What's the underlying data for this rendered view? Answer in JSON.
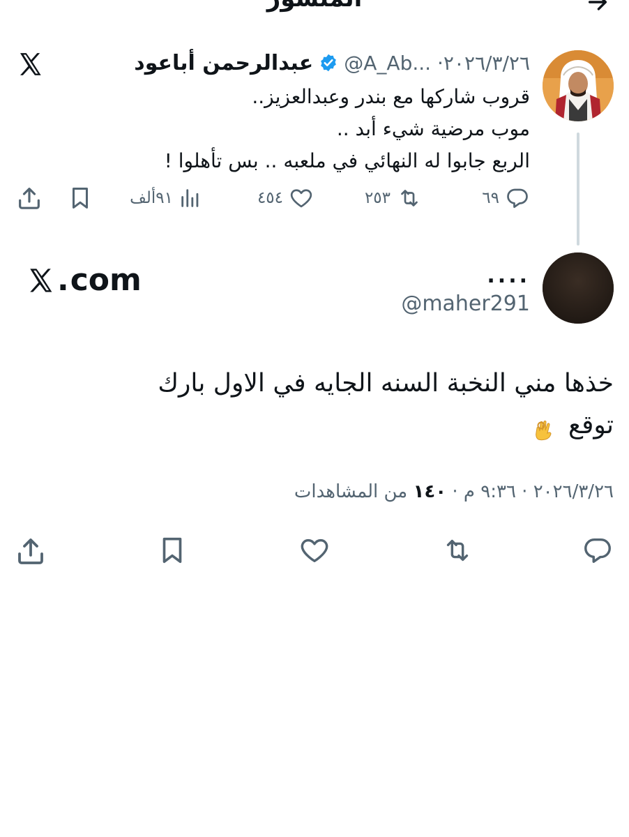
{
  "header": {
    "title": "المنشور",
    "back_icon": "arrow-right-icon"
  },
  "quoted_tweet": {
    "name": "عبدالرحمن أباعود",
    "verified_icon": "verified-badge-icon",
    "handle_date": "@A_Ab... ·٢٠٢٦/٣/٢٦",
    "platform_icon": "x-logo-icon",
    "text_lines": [
      "قروب شاركها مع بندر وعبدالعزيز..",
      "موب مرضية شيء أبد ..",
      "الربع جابوا له النهائي في ملعبه .. بس تأهلوا !"
    ],
    "actions": {
      "replies": "٦٩",
      "retweets": "٢٥٣",
      "likes": "٤٥٤",
      "views": "٩١ألف"
    }
  },
  "reply_tweet": {
    "name": "....",
    "handle": "@maher291",
    "source_label": "com",
    "text_lines": [
      "خذها مني النخبة السنه الجايه في الاول بارك",
      "توقع"
    ],
    "emoji": "ok-hand-emoji",
    "date": "٢٠٢٦/٣/٢٦ · ٩:٣٦ م · ",
    "views_count": "١٤٠",
    "views_label": " من المشاهدات"
  },
  "colors": {
    "text": "#0f1419",
    "secondary": "#536471",
    "verified": "#1d9bf0",
    "line": "#cfd9de"
  }
}
